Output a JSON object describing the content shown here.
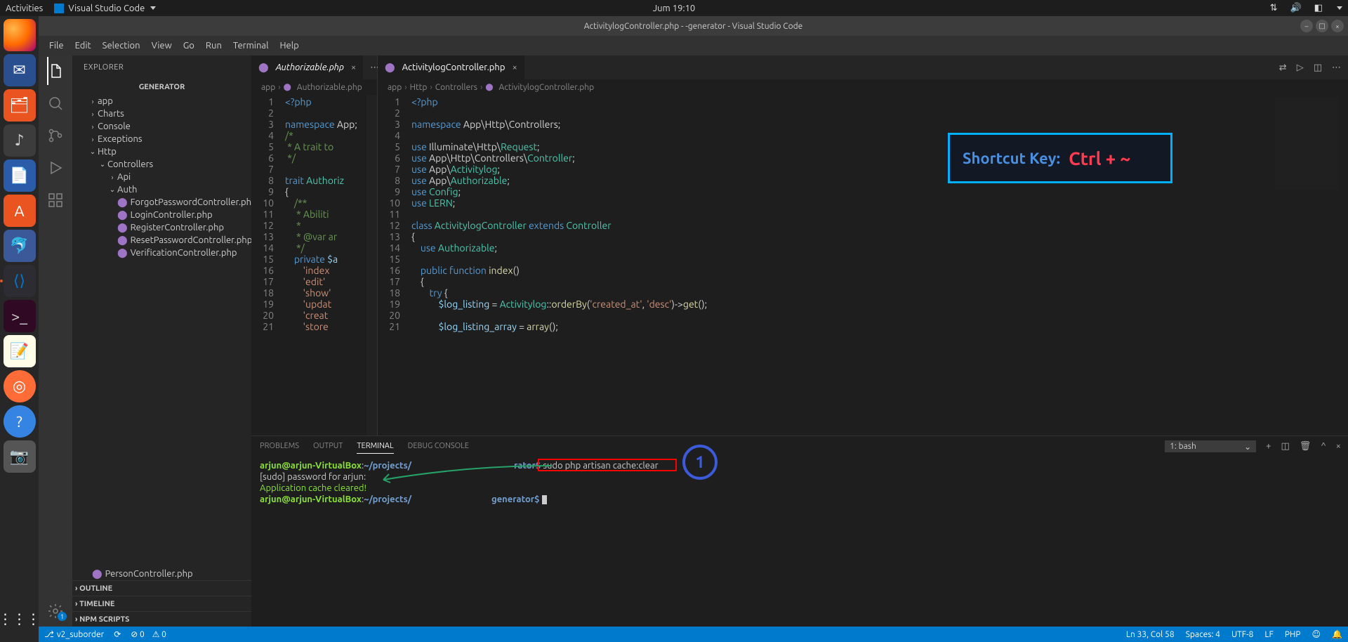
{
  "topbar": {
    "activities": "Activities",
    "app": "Visual Studio Code",
    "time": "Jum 19:10"
  },
  "titlebar": {
    "title": "ActivitylogController.php -          -generator - Visual Studio Code"
  },
  "menubar": [
    "File",
    "Edit",
    "Selection",
    "View",
    "Go",
    "Run",
    "Terminal",
    "Help"
  ],
  "sidebar": {
    "title": "EXPLORER",
    "project": "GENERATOR",
    "tree": [
      {
        "indent": 1,
        "chev": "›",
        "label": "app"
      },
      {
        "indent": 1,
        "chev": "›",
        "label": "Charts"
      },
      {
        "indent": 1,
        "chev": "›",
        "label": "Console"
      },
      {
        "indent": 1,
        "chev": "›",
        "label": "Exceptions"
      },
      {
        "indent": 1,
        "chev": "⌄",
        "label": "Http"
      },
      {
        "indent": 2,
        "chev": "⌄",
        "label": "Controllers"
      },
      {
        "indent": 3,
        "chev": "›",
        "label": "Api"
      },
      {
        "indent": 3,
        "chev": "⌄",
        "label": "Auth"
      },
      {
        "indent": 4,
        "icon": "php",
        "label": "ForgotPasswordController.php"
      },
      {
        "indent": 4,
        "icon": "php",
        "label": "LoginController.php"
      },
      {
        "indent": 4,
        "icon": "php",
        "label": "RegisterController.php"
      },
      {
        "indent": 4,
        "icon": "php",
        "label": "ResetPasswordController.php"
      },
      {
        "indent": 4,
        "icon": "php",
        "label": "VerificationController.php"
      }
    ],
    "bottom_file": "PersonController.php",
    "collapsibles": [
      "OUTLINE",
      "TIMELINE",
      "NPM SCRIPTS"
    ]
  },
  "editor_left": {
    "tab": "Authorizable.php",
    "breadcrumbs": [
      "app",
      "Authorizable.php"
    ],
    "lines": [
      [
        {
          "c": "kw",
          "t": "<?php"
        }
      ],
      [],
      [
        {
          "c": "kw",
          "t": "namespace"
        },
        {
          "c": "pun",
          "t": " App;"
        }
      ],
      [
        {
          "c": "cmt",
          "t": "/*"
        }
      ],
      [
        {
          "c": "cmt",
          "t": " * A trait to"
        }
      ],
      [
        {
          "c": "cmt",
          "t": " */"
        }
      ],
      [],
      [
        {
          "c": "kw",
          "t": "trait "
        },
        {
          "c": "cls",
          "t": "Authoriz"
        }
      ],
      [
        {
          "c": "pun",
          "t": "{"
        }
      ],
      [
        {
          "c": "cmt",
          "t": "    /**"
        }
      ],
      [
        {
          "c": "cmt",
          "t": "     * Abiliti"
        }
      ],
      [
        {
          "c": "cmt",
          "t": "     *"
        }
      ],
      [
        {
          "c": "cmt",
          "t": "     * @var ar"
        }
      ],
      [
        {
          "c": "cmt",
          "t": "     */"
        }
      ],
      [
        {
          "c": "kw",
          "t": "    private "
        },
        {
          "c": "var",
          "t": "$a"
        }
      ],
      [
        {
          "c": "str",
          "t": "        'index"
        }
      ],
      [
        {
          "c": "str",
          "t": "        'edit'"
        }
      ],
      [
        {
          "c": "str",
          "t": "        'show'"
        }
      ],
      [
        {
          "c": "str",
          "t": "        'updat"
        }
      ],
      [
        {
          "c": "str",
          "t": "        'creat"
        }
      ],
      [
        {
          "c": "str",
          "t": "        'store"
        }
      ]
    ]
  },
  "editor_right": {
    "tab": "ActivitylogController.php",
    "breadcrumbs": [
      "app",
      "Http",
      "Controllers",
      "ActivitylogController.php"
    ],
    "lines": [
      [
        {
          "c": "kw",
          "t": "<?php"
        }
      ],
      [],
      [
        {
          "c": "kw",
          "t": "namespace"
        },
        {
          "c": "pun",
          "t": " App\\Http\\Controllers;"
        }
      ],
      [],
      [
        {
          "c": "kw",
          "t": "use"
        },
        {
          "c": "pun",
          "t": " Illuminate\\Http\\"
        },
        {
          "c": "cls",
          "t": "Request"
        },
        {
          "c": "pun",
          "t": ";"
        }
      ],
      [
        {
          "c": "kw",
          "t": "use"
        },
        {
          "c": "pun",
          "t": " App\\Http\\Controllers\\"
        },
        {
          "c": "cls",
          "t": "Controller"
        },
        {
          "c": "pun",
          "t": ";"
        }
      ],
      [
        {
          "c": "kw",
          "t": "use"
        },
        {
          "c": "pun",
          "t": " App\\"
        },
        {
          "c": "cls",
          "t": "Activitylog"
        },
        {
          "c": "pun",
          "t": ";"
        }
      ],
      [
        {
          "c": "kw",
          "t": "use"
        },
        {
          "c": "pun",
          "t": " App\\"
        },
        {
          "c": "cls",
          "t": "Authorizable"
        },
        {
          "c": "pun",
          "t": ";"
        }
      ],
      [
        {
          "c": "kw",
          "t": "use"
        },
        {
          "c": "pun",
          "t": " "
        },
        {
          "c": "cls",
          "t": "Config"
        },
        {
          "c": "pun",
          "t": ";"
        }
      ],
      [
        {
          "c": "kw",
          "t": "use"
        },
        {
          "c": "pun",
          "t": " "
        },
        {
          "c": "cls",
          "t": "LERN"
        },
        {
          "c": "pun",
          "t": ";"
        }
      ],
      [],
      [
        {
          "c": "kw",
          "t": "class "
        },
        {
          "c": "cls",
          "t": "ActivitylogController"
        },
        {
          "c": "kw",
          "t": " extends "
        },
        {
          "c": "cls",
          "t": "Controller"
        }
      ],
      [
        {
          "c": "pun",
          "t": "{"
        }
      ],
      [
        {
          "c": "pun",
          "t": "    "
        },
        {
          "c": "kw",
          "t": "use "
        },
        {
          "c": "cls",
          "t": "Authorizable"
        },
        {
          "c": "pun",
          "t": ";"
        }
      ],
      [],
      [
        {
          "c": "pun",
          "t": "    "
        },
        {
          "c": "kw",
          "t": "public function "
        },
        {
          "c": "fn",
          "t": "index"
        },
        {
          "c": "pun",
          "t": "()"
        }
      ],
      [
        {
          "c": "pun",
          "t": "    {"
        }
      ],
      [
        {
          "c": "pun",
          "t": "        "
        },
        {
          "c": "kw",
          "t": "try"
        },
        {
          "c": "pun",
          "t": " {"
        }
      ],
      [
        {
          "c": "pun",
          "t": "            "
        },
        {
          "c": "var",
          "t": "$log_listing"
        },
        {
          "c": "pun",
          "t": " = "
        },
        {
          "c": "cls",
          "t": "Activitylog"
        },
        {
          "c": "pun",
          "t": "::"
        },
        {
          "c": "fn",
          "t": "orderBy"
        },
        {
          "c": "pun",
          "t": "("
        },
        {
          "c": "str",
          "t": "'created_at'"
        },
        {
          "c": "pun",
          "t": ", "
        },
        {
          "c": "str",
          "t": "'desc'"
        },
        {
          "c": "pun",
          "t": ")->"
        },
        {
          "c": "fn",
          "t": "get"
        },
        {
          "c": "pun",
          "t": "();"
        }
      ],
      [],
      [
        {
          "c": "pun",
          "t": "            "
        },
        {
          "c": "var",
          "t": "$log_listing_array"
        },
        {
          "c": "pun",
          "t": " = "
        },
        {
          "c": "fn",
          "t": "array"
        },
        {
          "c": "pun",
          "t": "();"
        }
      ]
    ]
  },
  "panel": {
    "tabs": [
      "PROBLEMS",
      "OUTPUT",
      "TERMINAL",
      "DEBUG CONSOLE"
    ],
    "active_tab": "TERMINAL",
    "shell": "1: bash",
    "terminal": {
      "line1_user": "arjun@arjun-VirtualBox",
      "line1_path": "~/projects/",
      "line1_prompt": "rator$ ",
      "line1_cmd": "sudo php artisan cache:clear",
      "line2": "[sudo] password for arjun: ",
      "line3": "Application cache cleared!",
      "line4_user": "arjun@arjun-VirtualBox",
      "line4_path": "~/projects/",
      "line4_prompt": "generator$ "
    }
  },
  "statusbar": {
    "branch": "v2_suborder",
    "sync": "⟳",
    "errors": "⊘ 0",
    "warnings": "⚠ 0",
    "right": [
      "Ln 33, Col 58",
      "Spaces: 4",
      "UTF-8",
      "LF",
      "PHP",
      "☺",
      "🔔"
    ]
  },
  "annotations": {
    "shortcut_label": "Shortcut Key:",
    "shortcut_key": "Ctrl + ~",
    "circle": "1"
  }
}
